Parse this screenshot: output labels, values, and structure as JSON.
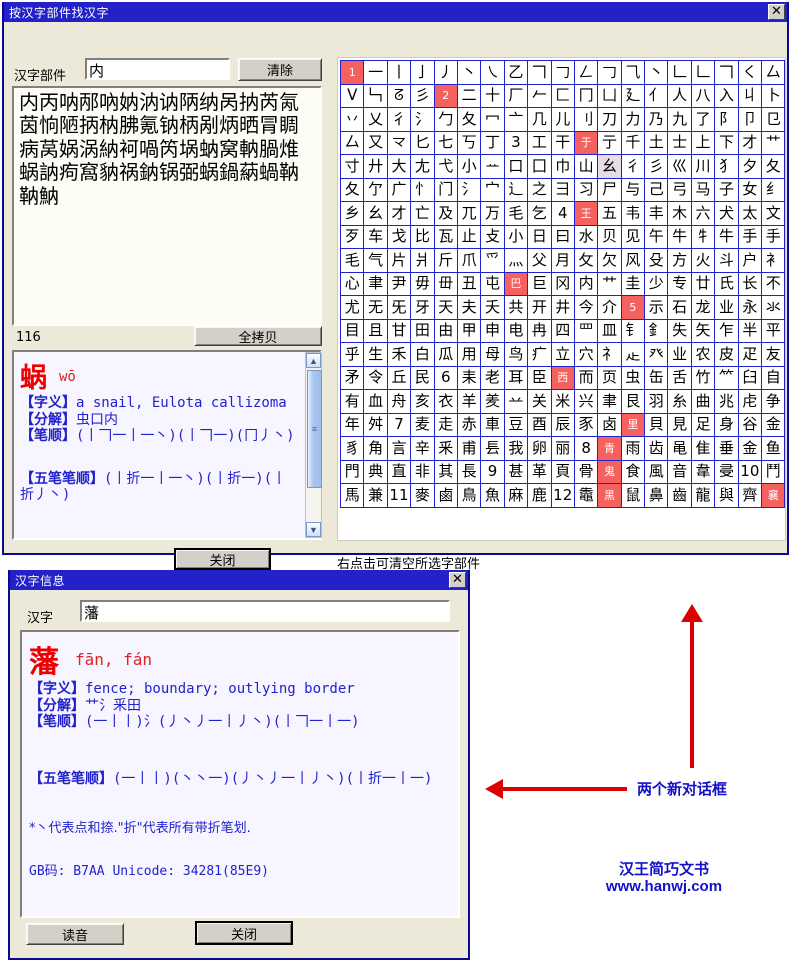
{
  "dialog1": {
    "title": "按汉字部件找汉字",
    "close_icon": "✕",
    "radical_label": "汉字部件",
    "radical_value": "内",
    "clear_button": "清除",
    "char_list": "内丙呐邴吶妠汭讷陃纳呙抐芮氝茵恦陋抦枘胇氪钠柄剐炳晒冐睭病莴娲涡納袔喎笍埚蚋窝軜腡焳蜗訥痀窩豽祸鈉锅弼蜗鍋蒳蝸靹靹魶",
    "count": "116",
    "copy_all_button": "全拷贝",
    "detail": {
      "character": "蜗",
      "pinyin": "wō",
      "meaning_tag": "【字义】",
      "meaning": "a snail, Eulota callizoma",
      "decomp_tag": "【分解】",
      "decomp": "虫口内",
      "strokes_tag": "【笔顺】",
      "strokes": "(丨𠃍一丨一丶)(丨𠃍一)(冂丿丶)",
      "wubi_tag": "【五笔笔顺】",
      "wubi": "(丨折一丨一丶)(丨折一)(丨折丿丶)"
    },
    "close_button": "关闭",
    "hint": "右点击可清空所选字部件"
  },
  "radical_grid": {
    "columns": 19,
    "cells": [
      "1",
      "一",
      "丨",
      "亅",
      "丿",
      "丶",
      "㇏",
      "乙",
      "𠃍",
      "𠃌",
      "𠃋",
      "𠃌",
      "⺄",
      "丶",
      "𠃊",
      "𠃊",
      "𠃍",
      "く",
      "厶",
      "ᐯ",
      "𠃑",
      "ᘔ",
      "彡",
      "2",
      "二",
      "十",
      "厂",
      "𠂉",
      "匚",
      "冂",
      "凵",
      "廴",
      "亻",
      "人",
      "八",
      "入",
      "丩",
      "卜",
      "丷",
      "乂",
      "彳",
      "氵",
      "勹",
      "夂",
      "冖",
      "亠",
      "几",
      "儿",
      "刂",
      "刀",
      "力",
      "乃",
      "九",
      "了",
      "阝",
      "卩",
      "㔾",
      "厶",
      "又",
      "龴",
      "匕",
      "七",
      "丂",
      "丁",
      "3",
      "工",
      "干",
      "于",
      "亍",
      "千",
      "土",
      "士",
      "上",
      "下",
      "才",
      "艹",
      "寸",
      "廾",
      "大",
      "尢",
      "弋",
      "小",
      "ᅭ",
      "口",
      "囗",
      "巾",
      "山",
      "幺",
      "彳",
      "彡",
      "巛",
      "川",
      "犭",
      "夕",
      "夂",
      "夂",
      "亇",
      "广",
      "忄",
      "门",
      "氵",
      "宀",
      "辶",
      "之",
      "彐",
      "习",
      "尸",
      "与",
      "己",
      "弓",
      "马",
      "子",
      "女",
      "纟",
      "乡",
      "幺",
      "才",
      "亡",
      "及",
      "兀",
      "万",
      "毛",
      "乞",
      "4",
      "王",
      "五",
      "韦",
      "丰",
      "木",
      "六",
      "犬",
      "太",
      "文",
      "歹",
      "车",
      "戈",
      "比",
      "瓦",
      "止",
      "攴",
      "小",
      "日",
      "曰",
      "水",
      "贝",
      "见",
      "午",
      "牛",
      "牜",
      "牛",
      "手",
      "手",
      "毛",
      "气",
      "片",
      "爿",
      "斤",
      "爪",
      "爫",
      "灬",
      "父",
      "月",
      "攵",
      "欠",
      "风",
      "殳",
      "方",
      "火",
      "斗",
      "户",
      "衤",
      "心",
      "聿",
      "尹",
      "毋",
      "毌",
      "丑",
      "屯",
      "巴",
      "巨",
      "冈",
      "内",
      "艹",
      "圭",
      "少",
      "专",
      "廿",
      "氏",
      "长",
      "不",
      "尤",
      "无",
      "旡",
      "牙",
      "天",
      "夫",
      "夭",
      "共",
      "开",
      "井",
      "今",
      "介",
      "5",
      "示",
      "石",
      "龙",
      "业",
      "永",
      "氺",
      "目",
      "且",
      "甘",
      "田",
      "由",
      "甲",
      "申",
      "电",
      "冉",
      "四",
      "罒",
      "皿",
      "钅",
      "釒",
      "失",
      "矢",
      "乍",
      "半",
      "平",
      "乎",
      "生",
      "禾",
      "白",
      "瓜",
      "用",
      "母",
      "鸟",
      "疒",
      "立",
      "穴",
      "礻",
      "龰",
      "癶",
      "业",
      "农",
      "皮",
      "疋",
      "友",
      "矛",
      "令",
      "丘",
      "民",
      "6",
      "耒",
      "老",
      "耳",
      "臣",
      "西",
      "而",
      "页",
      "虫",
      "缶",
      "舌",
      "竹",
      "⺮",
      "臼",
      "自",
      "有",
      "血",
      "舟",
      "亥",
      "衣",
      "羊",
      "羑",
      "䒑",
      "关",
      "米",
      "兴",
      "聿",
      "艮",
      "羽",
      "糸",
      "曲",
      "兆",
      "虍",
      "争",
      "年",
      "舛",
      "7",
      "麦",
      "走",
      "赤",
      "車",
      "豆",
      "酉",
      "辰",
      "豕",
      "卤",
      "里",
      "貝",
      "見",
      "足",
      "身",
      "谷",
      "金",
      "豸",
      "角",
      "言",
      "辛",
      "釆",
      "甫",
      "镸",
      "我",
      "卵",
      "丽",
      "8",
      "青",
      "雨",
      "齿",
      "黾",
      "隹",
      "垂",
      "金",
      "鱼",
      "門",
      "典",
      "直",
      "非",
      "其",
      "長",
      "9",
      "甚",
      "革",
      "頁",
      "骨",
      "鬼",
      "食",
      "風",
      "音",
      "韋",
      "𠬶",
      "10",
      "鬥",
      "馬",
      "兼",
      "11",
      "麥",
      "鹵",
      "鳥",
      "魚",
      "麻",
      "鹿",
      "12",
      "鼄",
      "黑",
      "鼠",
      "鼻",
      "齒",
      "龍",
      "與",
      "齊",
      "襄"
    ],
    "number_cells": [
      0,
      23,
      67,
      124,
      178,
      202,
      256,
      297,
      315,
      334,
      353,
      360,
      362,
      364,
      366,
      368,
      370,
      372
    ],
    "selected_index": 87
  },
  "dialog2": {
    "title": "汉字信息",
    "close_icon": "✕",
    "hz_label": "汉字",
    "hz_value": "藩",
    "detail": {
      "character": "藩",
      "pinyin": "fān, fán",
      "meaning_tag": "【字义】",
      "meaning": "fence; boundary; outlying border",
      "decomp_tag": "【分解】",
      "decomp": "艹氵釆田",
      "strokes_tag": "【笔顺】",
      "strokes": "(一丨丨)氵(丿丶丿一丨丿丶)(丨𠃍一丨一)",
      "wubi_tag": "【五笔笔顺】",
      "wubi": "(一丨丨)(丶丶一)(丿丶丿一丨丿丶)(丨折一丨一)",
      "note": "*丶代表点和捺.\"折\"代表所有带折笔划.",
      "gb_line": "GB码: B7AA    Unicode: 34281(85E9)"
    },
    "read_button": "读音",
    "close_button": "关闭"
  },
  "annotations": {
    "callout": "两个新对话框",
    "brand_name": "汉王简巧文书",
    "brand_url": "www.hanwj.com"
  }
}
